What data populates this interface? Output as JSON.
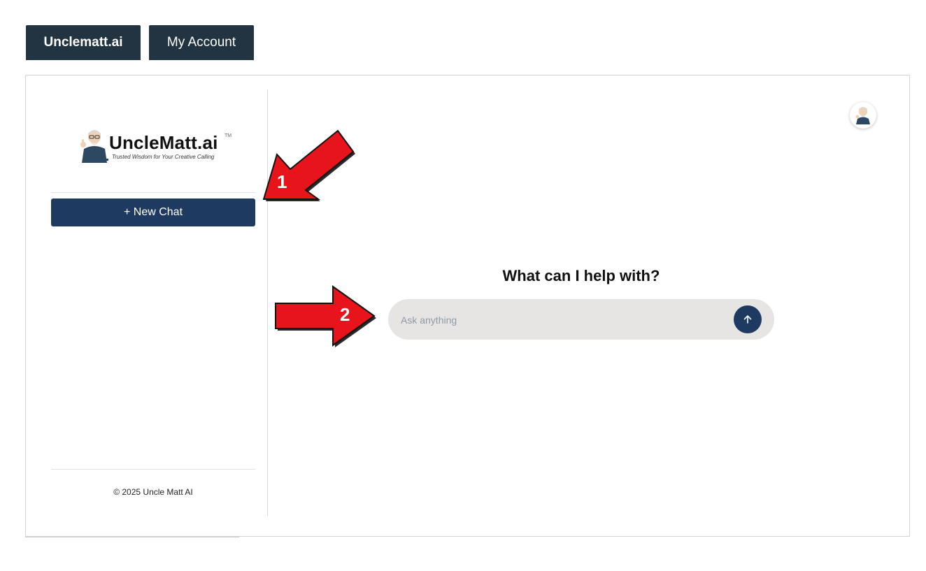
{
  "tabs": [
    {
      "label": "Unclematt.ai",
      "active": true
    },
    {
      "label": "My Account",
      "active": false
    }
  ],
  "sidebar": {
    "logo": {
      "name": "UncleMatt.ai",
      "trademark": "TM",
      "tagline": "Trusted Wisdom for Your Creative Calling"
    },
    "new_chat_label": "+ New Chat",
    "footer": "© 2025 Uncle Matt AI"
  },
  "main": {
    "heading": "What can I help with?",
    "input": {
      "placeholder": "Ask anything",
      "value": ""
    },
    "send_icon": "arrow-up-icon",
    "avatar_icon": "uncle-matt-avatar"
  },
  "annotations": [
    {
      "number": "1",
      "color": "#e8141c"
    },
    {
      "number": "2",
      "color": "#e8141c"
    }
  ],
  "colors": {
    "tab_bg": "#223441",
    "primary_button": "#1f3a60",
    "input_bg": "#e7e5e4"
  }
}
